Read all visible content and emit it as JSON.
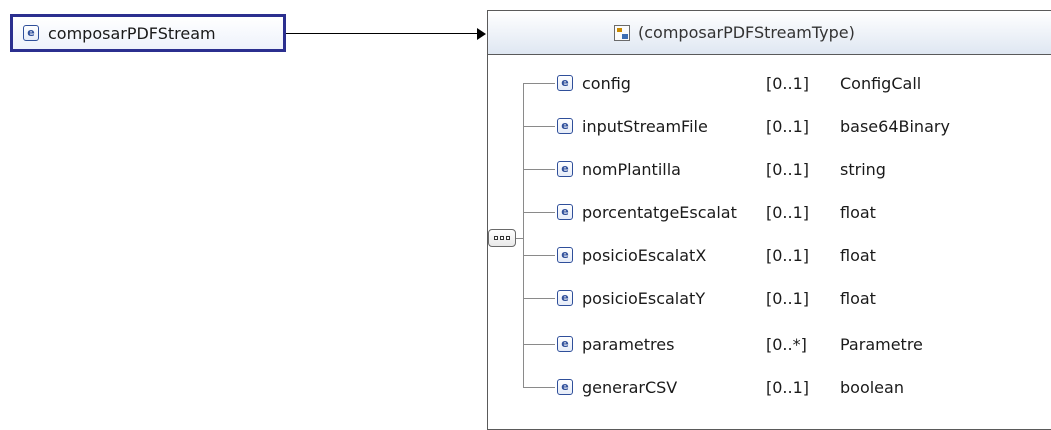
{
  "root": {
    "name": "composarPDFStream"
  },
  "type": {
    "label": "(composarPDFStreamType)"
  },
  "children": [
    {
      "name": "config",
      "cardinality": "[0..1]",
      "type": "ConfigCall"
    },
    {
      "name": "inputStreamFile",
      "cardinality": "[0..1]",
      "type": "base64Binary"
    },
    {
      "name": "nomPlantilla",
      "cardinality": "[0..1]",
      "type": "string"
    },
    {
      "name": "porcentatgeEscalat",
      "cardinality": "[0..1]",
      "type": "float"
    },
    {
      "name": "posicioEscalatX",
      "cardinality": "[0..1]",
      "type": "float"
    },
    {
      "name": "posicioEscalatY",
      "cardinality": "[0..1]",
      "type": "float"
    },
    {
      "name": "parametres",
      "cardinality": "[0..*]",
      "type": "Parametre"
    },
    {
      "name": "generarCSV",
      "cardinality": "[0..1]",
      "type": "boolean"
    }
  ],
  "icons": {
    "element": "element-icon",
    "complex_type": "complex-type-icon",
    "sequence": "sequence-compositor-icon"
  },
  "colors": {
    "root_border": "#2b2f8f",
    "icon_blue": "#2f4f9a"
  }
}
